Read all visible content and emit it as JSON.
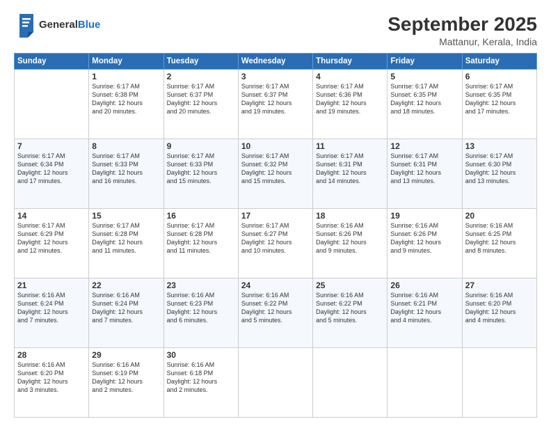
{
  "header": {
    "logo_general": "General",
    "logo_blue": "Blue",
    "title": "September 2025",
    "location": "Mattanur, Kerala, India"
  },
  "weekdays": [
    "Sunday",
    "Monday",
    "Tuesday",
    "Wednesday",
    "Thursday",
    "Friday",
    "Saturday"
  ],
  "weeks": [
    [
      {
        "day": "",
        "info": ""
      },
      {
        "day": "1",
        "info": "Sunrise: 6:17 AM\nSunset: 6:38 PM\nDaylight: 12 hours\nand 20 minutes."
      },
      {
        "day": "2",
        "info": "Sunrise: 6:17 AM\nSunset: 6:37 PM\nDaylight: 12 hours\nand 20 minutes."
      },
      {
        "day": "3",
        "info": "Sunrise: 6:17 AM\nSunset: 6:37 PM\nDaylight: 12 hours\nand 19 minutes."
      },
      {
        "day": "4",
        "info": "Sunrise: 6:17 AM\nSunset: 6:36 PM\nDaylight: 12 hours\nand 19 minutes."
      },
      {
        "day": "5",
        "info": "Sunrise: 6:17 AM\nSunset: 6:35 PM\nDaylight: 12 hours\nand 18 minutes."
      },
      {
        "day": "6",
        "info": "Sunrise: 6:17 AM\nSunset: 6:35 PM\nDaylight: 12 hours\nand 17 minutes."
      }
    ],
    [
      {
        "day": "7",
        "info": "Sunrise: 6:17 AM\nSunset: 6:34 PM\nDaylight: 12 hours\nand 17 minutes."
      },
      {
        "day": "8",
        "info": "Sunrise: 6:17 AM\nSunset: 6:33 PM\nDaylight: 12 hours\nand 16 minutes."
      },
      {
        "day": "9",
        "info": "Sunrise: 6:17 AM\nSunset: 6:33 PM\nDaylight: 12 hours\nand 15 minutes."
      },
      {
        "day": "10",
        "info": "Sunrise: 6:17 AM\nSunset: 6:32 PM\nDaylight: 12 hours\nand 15 minutes."
      },
      {
        "day": "11",
        "info": "Sunrise: 6:17 AM\nSunset: 6:31 PM\nDaylight: 12 hours\nand 14 minutes."
      },
      {
        "day": "12",
        "info": "Sunrise: 6:17 AM\nSunset: 6:31 PM\nDaylight: 12 hours\nand 13 minutes."
      },
      {
        "day": "13",
        "info": "Sunrise: 6:17 AM\nSunset: 6:30 PM\nDaylight: 12 hours\nand 13 minutes."
      }
    ],
    [
      {
        "day": "14",
        "info": "Sunrise: 6:17 AM\nSunset: 6:29 PM\nDaylight: 12 hours\nand 12 minutes."
      },
      {
        "day": "15",
        "info": "Sunrise: 6:17 AM\nSunset: 6:28 PM\nDaylight: 12 hours\nand 11 minutes."
      },
      {
        "day": "16",
        "info": "Sunrise: 6:17 AM\nSunset: 6:28 PM\nDaylight: 12 hours\nand 11 minutes."
      },
      {
        "day": "17",
        "info": "Sunrise: 6:17 AM\nSunset: 6:27 PM\nDaylight: 12 hours\nand 10 minutes."
      },
      {
        "day": "18",
        "info": "Sunrise: 6:16 AM\nSunset: 6:26 PM\nDaylight: 12 hours\nand 9 minutes."
      },
      {
        "day": "19",
        "info": "Sunrise: 6:16 AM\nSunset: 6:26 PM\nDaylight: 12 hours\nand 9 minutes."
      },
      {
        "day": "20",
        "info": "Sunrise: 6:16 AM\nSunset: 6:25 PM\nDaylight: 12 hours\nand 8 minutes."
      }
    ],
    [
      {
        "day": "21",
        "info": "Sunrise: 6:16 AM\nSunset: 6:24 PM\nDaylight: 12 hours\nand 7 minutes."
      },
      {
        "day": "22",
        "info": "Sunrise: 6:16 AM\nSunset: 6:24 PM\nDaylight: 12 hours\nand 7 minutes."
      },
      {
        "day": "23",
        "info": "Sunrise: 6:16 AM\nSunset: 6:23 PM\nDaylight: 12 hours\nand 6 minutes."
      },
      {
        "day": "24",
        "info": "Sunrise: 6:16 AM\nSunset: 6:22 PM\nDaylight: 12 hours\nand 5 minutes."
      },
      {
        "day": "25",
        "info": "Sunrise: 6:16 AM\nSunset: 6:22 PM\nDaylight: 12 hours\nand 5 minutes."
      },
      {
        "day": "26",
        "info": "Sunrise: 6:16 AM\nSunset: 6:21 PM\nDaylight: 12 hours\nand 4 minutes."
      },
      {
        "day": "27",
        "info": "Sunrise: 6:16 AM\nSunset: 6:20 PM\nDaylight: 12 hours\nand 4 minutes."
      }
    ],
    [
      {
        "day": "28",
        "info": "Sunrise: 6:16 AM\nSunset: 6:20 PM\nDaylight: 12 hours\nand 3 minutes."
      },
      {
        "day": "29",
        "info": "Sunrise: 6:16 AM\nSunset: 6:19 PM\nDaylight: 12 hours\nand 2 minutes."
      },
      {
        "day": "30",
        "info": "Sunrise: 6:16 AM\nSunset: 6:18 PM\nDaylight: 12 hours\nand 2 minutes."
      },
      {
        "day": "",
        "info": ""
      },
      {
        "day": "",
        "info": ""
      },
      {
        "day": "",
        "info": ""
      },
      {
        "day": "",
        "info": ""
      }
    ]
  ]
}
